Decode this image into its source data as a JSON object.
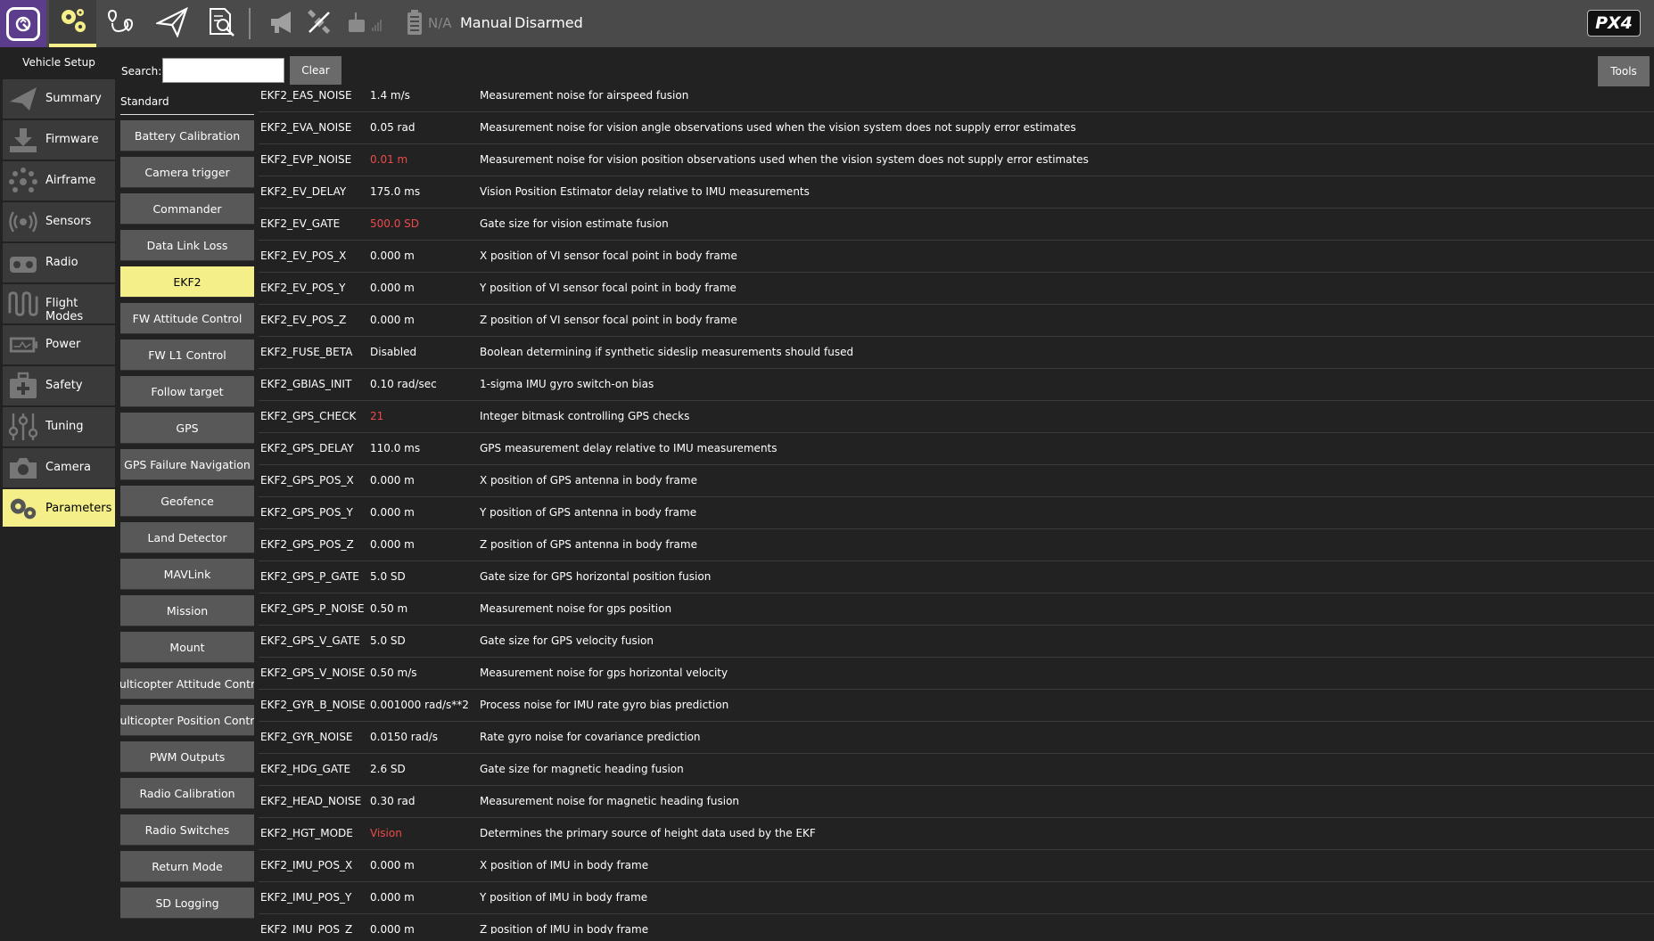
{
  "toolbar": {
    "battery_text": "N/A",
    "flight_mode": "Manual",
    "armed_state": "Disarmed",
    "brand_logo_text": "PX4",
    "accent_color": "#f5ef8a",
    "qgc_color": "#5c3d8c",
    "icons": [
      "qgc-logo-icon",
      "settings-gear-icon",
      "plan-route-icon",
      "fly-paper-plane-icon",
      "analyze-document-icon",
      "messages-megaphone-icon",
      "gps-satellite-icon",
      "rc-transmitter-icon",
      "battery-icon"
    ]
  },
  "setup": {
    "title": "Vehicle Setup",
    "items": [
      {
        "label": "Summary",
        "icon": "paper-plane-icon"
      },
      {
        "label": "Firmware",
        "icon": "download-icon"
      },
      {
        "label": "Airframe",
        "icon": "airframe-dots-icon"
      },
      {
        "label": "Sensors",
        "icon": "sensor-waves-icon"
      },
      {
        "label": "Radio",
        "icon": "radio-controller-icon"
      },
      {
        "label": "Flight Modes",
        "icon": "flight-modes-wave-icon"
      },
      {
        "label": "Power",
        "icon": "power-battery-icon"
      },
      {
        "label": "Safety",
        "icon": "safety-medkit-icon"
      },
      {
        "label": "Tuning",
        "icon": "tuning-sliders-icon"
      },
      {
        "label": "Camera",
        "icon": "camera-icon"
      },
      {
        "label": "Parameters",
        "icon": "parameters-gears-icon",
        "active": true
      }
    ]
  },
  "search": {
    "label": "Search:",
    "value": "",
    "clear_label": "Clear",
    "tools_label": "Tools"
  },
  "groups": {
    "header": "Standard",
    "items": [
      "Battery Calibration",
      "Camera trigger",
      "Commander",
      "Data Link Loss",
      "EKF2",
      "FW Attitude Control",
      "FW L1 Control",
      "Follow target",
      "GPS",
      "GPS Failure Navigation",
      "Geofence",
      "Land Detector",
      "MAVLink",
      "Mission",
      "Mount",
      "Multicopter Attitude Control",
      "Multicopter Position Control",
      "PWM Outputs",
      "Radio Calibration",
      "Radio Switches",
      "Return Mode",
      "SD Logging"
    ],
    "active": "EKF2"
  },
  "params": [
    {
      "name": "EKF2_EAS_NOISE",
      "value": "1.4 m/s",
      "modified": false,
      "desc": "Measurement noise for airspeed fusion"
    },
    {
      "name": "EKF2_EVA_NOISE",
      "value": "0.05 rad",
      "modified": false,
      "desc": "Measurement noise for vision angle observations used when the vision system does not supply error estimates"
    },
    {
      "name": "EKF2_EVP_NOISE",
      "value": "0.01 m",
      "modified": true,
      "desc": "Measurement noise for vision position observations used when the vision system does not supply error estimates"
    },
    {
      "name": "EKF2_EV_DELAY",
      "value": "175.0 ms",
      "modified": false,
      "desc": "Vision Position Estimator delay relative to IMU measurements"
    },
    {
      "name": "EKF2_EV_GATE",
      "value": "500.0 SD",
      "modified": true,
      "desc": "Gate size for vision estimate fusion"
    },
    {
      "name": "EKF2_EV_POS_X",
      "value": "0.000 m",
      "modified": false,
      "desc": "X position of VI sensor focal point in body frame"
    },
    {
      "name": "EKF2_EV_POS_Y",
      "value": "0.000 m",
      "modified": false,
      "desc": "Y position of VI sensor focal point in body frame"
    },
    {
      "name": "EKF2_EV_POS_Z",
      "value": "0.000 m",
      "modified": false,
      "desc": "Z position of VI sensor focal point in body frame"
    },
    {
      "name": "EKF2_FUSE_BETA",
      "value": "Disabled",
      "modified": false,
      "desc": "Boolean determining if synthetic sideslip measurements should fused"
    },
    {
      "name": "EKF2_GBIAS_INIT",
      "value": "0.10 rad/sec",
      "modified": false,
      "desc": "1-sigma IMU gyro switch-on bias"
    },
    {
      "name": "EKF2_GPS_CHECK",
      "value": "21",
      "modified": true,
      "desc": "Integer bitmask controlling GPS checks"
    },
    {
      "name": "EKF2_GPS_DELAY",
      "value": "110.0 ms",
      "modified": false,
      "desc": "GPS measurement delay relative to IMU measurements"
    },
    {
      "name": "EKF2_GPS_POS_X",
      "value": "0.000 m",
      "modified": false,
      "desc": "X position of GPS antenna in body frame"
    },
    {
      "name": "EKF2_GPS_POS_Y",
      "value": "0.000 m",
      "modified": false,
      "desc": "Y position of GPS antenna in body frame"
    },
    {
      "name": "EKF2_GPS_POS_Z",
      "value": "0.000 m",
      "modified": false,
      "desc": "Z position of GPS antenna in body frame"
    },
    {
      "name": "EKF2_GPS_P_GATE",
      "value": "5.0 SD",
      "modified": false,
      "desc": "Gate size for GPS horizontal position fusion"
    },
    {
      "name": "EKF2_GPS_P_NOISE",
      "value": "0.50 m",
      "modified": false,
      "desc": "Measurement noise for gps position"
    },
    {
      "name": "EKF2_GPS_V_GATE",
      "value": "5.0 SD",
      "modified": false,
      "desc": "Gate size for GPS velocity fusion"
    },
    {
      "name": "EKF2_GPS_V_NOISE",
      "value": "0.50 m/s",
      "modified": false,
      "desc": "Measurement noise for gps horizontal velocity"
    },
    {
      "name": "EKF2_GYR_B_NOISE",
      "value": "0.001000 rad/s**2",
      "modified": false,
      "desc": "Process noise for IMU rate gyro bias prediction"
    },
    {
      "name": "EKF2_GYR_NOISE",
      "value": "0.0150 rad/s",
      "modified": false,
      "desc": "Rate gyro noise for covariance prediction"
    },
    {
      "name": "EKF2_HDG_GATE",
      "value": "2.6 SD",
      "modified": false,
      "desc": "Gate size for magnetic heading fusion"
    },
    {
      "name": "EKF2_HEAD_NOISE",
      "value": "0.30 rad",
      "modified": false,
      "desc": "Measurement noise for magnetic heading fusion"
    },
    {
      "name": "EKF2_HGT_MODE",
      "value": "Vision",
      "modified": true,
      "desc": "Determines the primary source of height data used by the EKF"
    },
    {
      "name": "EKF2_IMU_POS_X",
      "value": "0.000 m",
      "modified": false,
      "desc": "X position of IMU in body frame"
    },
    {
      "name": "EKF2_IMU_POS_Y",
      "value": "0.000 m",
      "modified": false,
      "desc": "Y position of IMU in body frame"
    },
    {
      "name": "EKF2_IMU_POS_Z",
      "value": "0.000 m",
      "modified": false,
      "desc": "Z position of IMU in body frame"
    }
  ]
}
